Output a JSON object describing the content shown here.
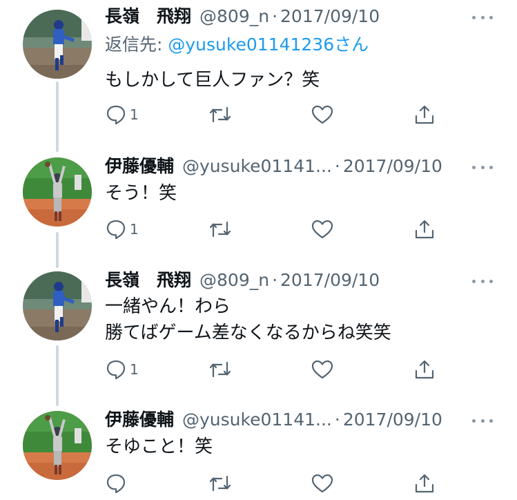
{
  "tweets": [
    {
      "name": "長嶺　飛翔",
      "handle": "@809_n",
      "dot": "·",
      "date": "2017/09/10",
      "reply_prefix": "返信先: ",
      "reply_mention": "@yusuke01141236さん",
      "lines": [
        "もしかして巨人ファン？笑"
      ],
      "reply_count": "1",
      "avatar": "pitcher-photo"
    },
    {
      "name": "伊藤優輔",
      "handle": "@yusuke01141...",
      "dot": "·",
      "date": "2017/09/10",
      "lines": [
        "そう！笑"
      ],
      "reply_count": "1",
      "avatar": "fielder-photo"
    },
    {
      "name": "長嶺　飛翔",
      "handle": "@809_n",
      "dot": "·",
      "date": "2017/09/10",
      "lines": [
        "一緒やん！わら",
        "勝てばゲーム差なくなるからね笑笑"
      ],
      "reply_count": "1",
      "avatar": "pitcher-photo"
    },
    {
      "name": "伊藤優輔",
      "handle": "@yusuke01141...",
      "dot": "·",
      "date": "2017/09/10",
      "lines": [
        "そゆこと！笑"
      ],
      "reply_count": "",
      "avatar": "fielder-photo"
    }
  ],
  "icons": {
    "reply": "reply-icon",
    "retweet": "retweet-icon",
    "like": "heart-icon",
    "share": "share-icon",
    "more": "more-icon"
  },
  "colors": {
    "text": "#0f1419",
    "secondary": "#536471",
    "mention": "#1d9bf0",
    "thread_line": "#cfd9de"
  }
}
